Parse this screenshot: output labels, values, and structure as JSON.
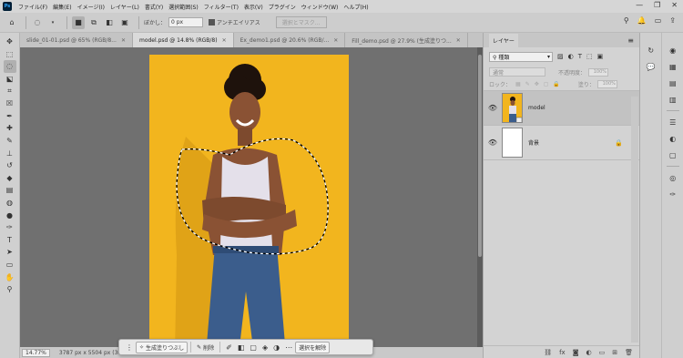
{
  "menubar": {
    "logo": "Ps",
    "items": [
      "ファイル(F)",
      "編集(E)",
      "イメージ(I)",
      "レイヤー(L)",
      "書式(Y)",
      "選択範囲(S)",
      "フィルター(T)",
      "表示(V)",
      "プラグイン",
      "ウィンドウ(W)",
      "ヘルプ(H)"
    ],
    "controls": [
      "—",
      "❐",
      "✕"
    ]
  },
  "options": {
    "feather_label": "ぼかし：",
    "feather_value": "0 px",
    "antialias_label": "アンチエイリアス",
    "select_mask_label": "選択とマスク..."
  },
  "tools": [
    {
      "name": "move-tool-icon",
      "glyph": "✥",
      "active": false
    },
    {
      "name": "marquee-tool-icon",
      "glyph": "⬚",
      "active": false
    },
    {
      "name": "lasso-tool-icon",
      "glyph": "◌",
      "active": true
    },
    {
      "name": "object-select-tool-icon",
      "glyph": "⬕",
      "active": false
    },
    {
      "name": "crop-tool-icon",
      "glyph": "⌗",
      "active": false
    },
    {
      "name": "frame-tool-icon",
      "glyph": "☒",
      "active": false
    },
    {
      "name": "eyedropper-tool-icon",
      "glyph": "✒",
      "active": false
    },
    {
      "name": "spot-heal-tool-icon",
      "glyph": "✚",
      "active": false
    },
    {
      "name": "brush-tool-icon",
      "glyph": "✎",
      "active": false
    },
    {
      "name": "stamp-tool-icon",
      "glyph": "⊥",
      "active": false
    },
    {
      "name": "history-brush-tool-icon",
      "glyph": "↺",
      "active": false
    },
    {
      "name": "eraser-tool-icon",
      "glyph": "◆",
      "active": false
    },
    {
      "name": "gradient-tool-icon",
      "glyph": "▤",
      "active": false
    },
    {
      "name": "blur-tool-icon",
      "glyph": "◍",
      "active": false
    },
    {
      "name": "dodge-tool-icon",
      "glyph": "●",
      "active": false
    },
    {
      "name": "pen-tool-icon",
      "glyph": "✑",
      "active": false
    },
    {
      "name": "type-tool-icon",
      "glyph": "T",
      "active": false
    },
    {
      "name": "path-select-tool-icon",
      "glyph": "➤",
      "active": false
    },
    {
      "name": "rectangle-tool-icon",
      "glyph": "▭",
      "active": false
    },
    {
      "name": "hand-tool-icon",
      "glyph": "✋",
      "active": false
    },
    {
      "name": "zoom-tool-icon",
      "glyph": "⚲",
      "active": false
    }
  ],
  "tabs": [
    {
      "label": "slide_01-01.psd @ 65% (RGB/8...",
      "active": false
    },
    {
      "label": "model.psd @ 14.8% (RGB/8)",
      "active": true
    },
    {
      "label": "Ex_demo1.psd @ 20.6% (RGB/...",
      "active": false
    },
    {
      "label": "Fill_demo.psd @ 27.9% (生成塗りつ...",
      "active": false
    }
  ],
  "status": {
    "zoom": "14.77%",
    "docsize": "3787 px x 5504 px (30..."
  },
  "context_bar": {
    "generative_fill": "生成塗りつぶし",
    "delete": "削除",
    "deselect": "選択を解除"
  },
  "layers_panel": {
    "title": "レイヤー",
    "filter": "種類",
    "blend_mode": "通常",
    "opacity_label": "不透明度：",
    "opacity": "100%",
    "lock_label": "ロック：",
    "fill_label": "塗り：",
    "fill": "100%",
    "layers": [
      {
        "name": "model",
        "selected": true,
        "locked": false
      },
      {
        "name": "背景",
        "selected": false,
        "locked": true
      }
    ]
  }
}
